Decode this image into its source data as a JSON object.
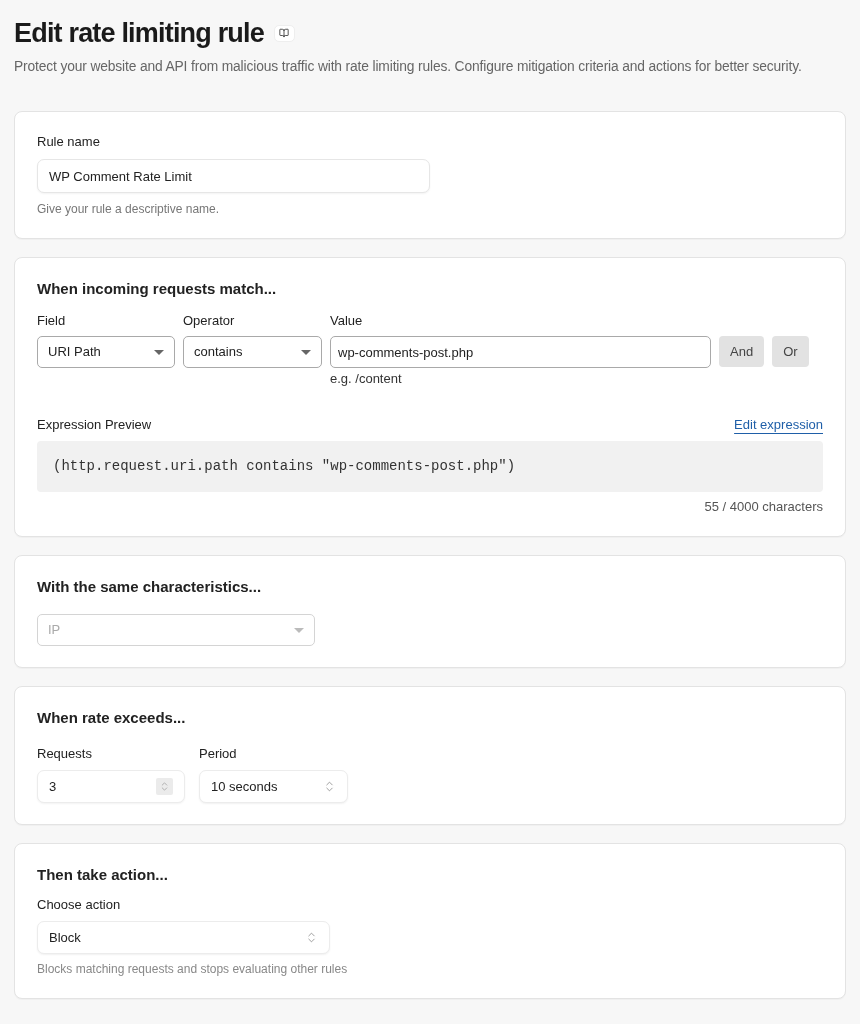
{
  "header": {
    "title": "Edit rate limiting rule",
    "subtitle": "Protect your website and API from malicious traffic with rate limiting rules. Configure mitigation criteria and actions for better security."
  },
  "rule_name_card": {
    "label": "Rule name",
    "value": "WP Comment Rate Limit",
    "hint": "Give your rule a descriptive name."
  },
  "match_card": {
    "heading": "When incoming requests match...",
    "field": {
      "label": "Field",
      "value": "URI Path"
    },
    "operator": {
      "label": "Operator",
      "value": "contains"
    },
    "value": {
      "label": "Value",
      "value": "wp-comments-post.php",
      "hint": "e.g. /content"
    },
    "buttons": [
      "And",
      "Or"
    ],
    "expression_preview": {
      "label": "Expression Preview",
      "link": "Edit expression",
      "code": "(http.request.uri.path contains \"wp-comments-post.php\")",
      "counter": "55 / 4000 characters"
    }
  },
  "characteristics_card": {
    "heading": "With the same characteristics...",
    "select": {
      "value": "IP",
      "disabled": true
    }
  },
  "rate_card": {
    "heading": "When rate exceeds...",
    "requests": {
      "label": "Requests",
      "value": "3"
    },
    "period": {
      "label": "Period",
      "value": "10 seconds"
    }
  },
  "action_card": {
    "heading": "Then take action...",
    "label": "Choose action",
    "value": "Block",
    "hint": "Blocks matching requests and stops evaluating other rules"
  }
}
